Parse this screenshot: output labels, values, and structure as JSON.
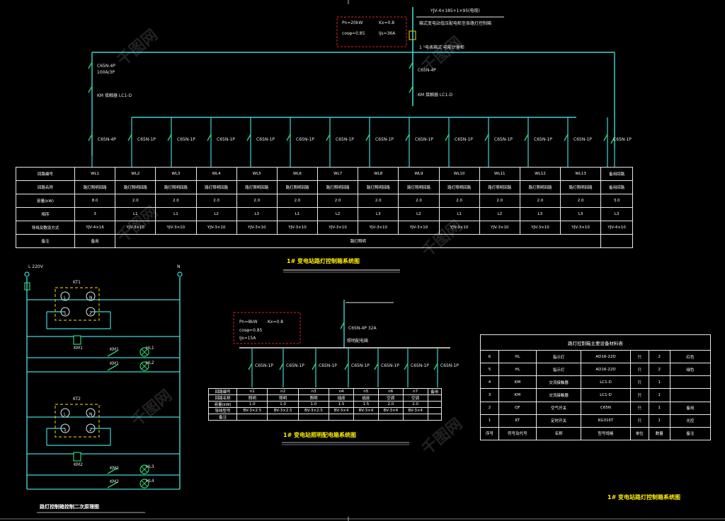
{
  "watermark": "千图网",
  "main_diagram": {
    "source_label": "YJV-4×185+1×95(电缆)",
    "bus_label": "箱式变电站低压配电柜至各路灯控制箱",
    "meter_label": "1 ¹电表箱式  电能计量柜",
    "breaker_left_1": "C65N-4P",
    "breaker_left_1b": "100A/3P",
    "breaker_left_2": "KM  接触器  LC1-D",
    "breaker_mid_1": "C65N-4P",
    "breaker_mid_2": "KM  接触器  LC1-D",
    "feeder_labels": [
      "C65N-4P",
      "C65N-1P",
      "C65N-1P",
      "C65N-1P",
      "C65N-1P",
      "C65N-1P",
      "C65N-1P",
      "C65N-1P",
      "C65N-1P",
      "C65N-1P",
      "C65N-1P",
      "C65N-1P",
      "C65N-1P",
      "C65N-1P",
      "C65N-4P"
    ],
    "legend_lines": [
      "Pn=20kW",
      "Kx=0.8",
      "cosφ=0.85",
      "Ijs=36A"
    ],
    "title": "1# 变电站路灯控制箱系统图",
    "table": {
      "row_headers": [
        "回路编号",
        "回路名称",
        "容量(kW)",
        "相序",
        "导线及敷设方式",
        "备注"
      ],
      "cols": [
        [
          "WL1",
          "路灯照明回路",
          "8.0",
          "3",
          "YJV-4×16",
          "备用"
        ],
        [
          "WL2",
          "路灯照明回路",
          "2.0",
          "L1",
          "YJV-3×10",
          ""
        ],
        [
          "WL3",
          "路灯照明回路",
          "2.0",
          "L1",
          "YJV-3×10",
          ""
        ],
        [
          "WL4",
          "路灯照明回路",
          "2.0",
          "L2",
          "YJV-3×10",
          ""
        ],
        [
          "WL5",
          "路灯照明回路",
          "2.0",
          "L3",
          "YJV-3×10",
          ""
        ],
        [
          "WL6",
          "路灯照明回路",
          "2.0",
          "L1",
          "YJV-3×10",
          ""
        ],
        [
          "WL7",
          "路灯照明回路",
          "2.0",
          "L2",
          "YJV-3×10",
          ""
        ],
        [
          "WL8",
          "路灯照明回路",
          "2.0",
          "L3",
          "YJV-3×10",
          ""
        ],
        [
          "WL9",
          "路灯照明回路",
          "2.0",
          "L2",
          "YJV-3×10",
          ""
        ],
        [
          "WL10",
          "路灯照明回路",
          "2.0",
          "L1",
          "YJV-3×10",
          ""
        ],
        [
          "WL11",
          "路灯照明回路",
          "2.0",
          "L2",
          "YJV-3×10",
          ""
        ],
        [
          "WL12",
          "路灯照明回路",
          "2.0",
          "L3",
          "YJV-3×10",
          ""
        ],
        [
          "WL13",
          "路灯照明回路",
          "2.0",
          "L3",
          "YJV-3×10",
          ""
        ],
        [
          "备用回路",
          "备用回路",
          "3.0",
          "L3",
          "YJV-4×10",
          ""
        ]
      ],
      "remark_span": "路灯照明"
    }
  },
  "control_circuit": {
    "title": "路灯控制箱控制二次原理图",
    "supply_left": "L  220V",
    "supply_right": "N",
    "timer_1": "KT1",
    "timer_2": "KT2",
    "terminals": [
      "L",
      "N",
      "1",
      "2"
    ],
    "coil_1": "KM1",
    "coil_2": "KM2",
    "contact_labels": [
      "KM1",
      "KM1",
      "KM2",
      "KM2"
    ],
    "lamp_labels": [
      "HL1",
      "HL2",
      "HL3",
      "HL4"
    ]
  },
  "sub_diagram": {
    "title": "1# 变电站照明配电箱系统图",
    "incoming": "C65N-4P 32A",
    "bus_label": "照明配电箱",
    "legend_lines": [
      "Pn=8kW",
      "Kx=0.8",
      "cosφ=0.85",
      "Ijs=15A"
    ],
    "feeders": [
      "C65N-1P",
      "C65N-1P",
      "C65N-1P",
      "C65N-1P",
      "C65N-1P",
      "C65N-1P",
      "C65N-1P"
    ],
    "table": [
      [
        "回路编号",
        "n1",
        "n2",
        "n3",
        "n4",
        "n5",
        "n6",
        "n7",
        "备用"
      ],
      [
        "回路名称",
        "照明",
        "照明",
        "照明",
        "插座",
        "插座",
        "空调",
        "空调",
        ""
      ],
      [
        "容量(kW)",
        "1.0",
        "1.0",
        "1.0",
        "1.5",
        "1.5",
        "2.0",
        "2.0",
        ""
      ],
      [
        "导线型号",
        "BV-3×2.5",
        "BV-3×2.5",
        "BV-3×2.5",
        "BV-3×4",
        "BV-3×4",
        "BV-3×4",
        "BV-3×4",
        ""
      ],
      [
        "备注",
        "",
        "",
        "",
        "",
        "",
        "",
        "",
        ""
      ]
    ]
  },
  "materials": {
    "title": "路灯控制箱主要设备材料表",
    "rows": [
      [
        "6",
        "HL",
        "指示灯",
        "AD16-22D",
        "只",
        "2",
        "红色"
      ],
      [
        "5",
        "HL",
        "指示灯",
        "AD16-22D",
        "只",
        "2",
        "绿色"
      ],
      [
        "4",
        "KM",
        "交流接触器",
        "LC1-D",
        "只",
        "1",
        ""
      ],
      [
        "3",
        "KM",
        "交流接触器",
        "LC1-D",
        "只",
        "1",
        ""
      ],
      [
        "2",
        "QF",
        "空气开关",
        "C65N",
        "只",
        "1",
        "备用"
      ],
      [
        "1",
        "KT",
        "定时开关",
        "KG316T",
        "只",
        "1",
        "光控"
      ],
      [
        "序号",
        "符号及代号",
        "名称",
        "型号规格",
        "单位",
        "数量",
        "备注"
      ]
    ]
  },
  "page_title": "1# 变电站路灯控制箱系统图"
}
